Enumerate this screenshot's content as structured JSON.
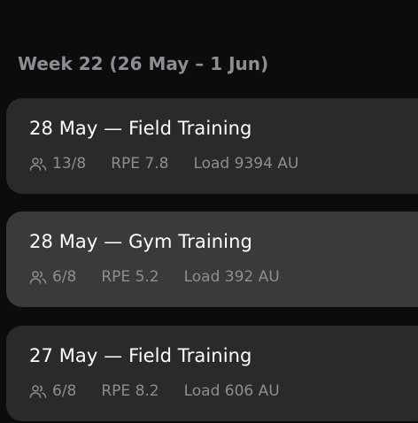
{
  "week": {
    "header": "Week 22 (26 May – 1 Jun)"
  },
  "sessions": [
    {
      "title": "28 May — Field Training",
      "attendance": "13/8",
      "rpe": "RPE 7.8",
      "load": "Load 9394 AU",
      "icon": "athletes-icon"
    },
    {
      "title": "28 May — Gym Training",
      "attendance": "6/8",
      "rpe": "RPE 5.2",
      "load": "Load 392 AU",
      "icon": "athletes-icon"
    },
    {
      "title": "27 May — Field Training",
      "attendance": "6/8",
      "rpe": "RPE 8.2",
      "load": "Load 606 AU",
      "icon": "athletes-icon"
    }
  ],
  "colors": {
    "background": "#0c0c0d",
    "card": "#2a2a2c",
    "card_highlighted": "#3a3a3c",
    "text_primary": "#ffffff",
    "text_secondary": "#8d8d92"
  }
}
